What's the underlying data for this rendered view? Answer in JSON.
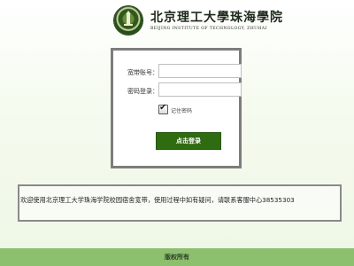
{
  "header": {
    "school_name": "北京理工大學珠海學院",
    "school_name_en": "BEIJING INSTITUTE OF TECHNOLOGY, ZHUHAI",
    "logo_icon": "school-emblem-icon"
  },
  "login": {
    "account_label": "宽带账号：",
    "account_value": "",
    "password_label": "密码登录：",
    "password_value": "",
    "remember_label": "记住密码",
    "remember_checked": true,
    "login_button_label": "点击登录"
  },
  "notice": {
    "text": "欢迎使用北京理工大学珠海学院校园宿舍宽带，使用过程中如有疑问，请联系客服中心38535303"
  },
  "footer": {
    "text": "版权所有"
  },
  "colors": {
    "accent_green": "#2f6b10",
    "footer_green": "#8cbf6e",
    "border_gray": "#7d7d7d"
  }
}
